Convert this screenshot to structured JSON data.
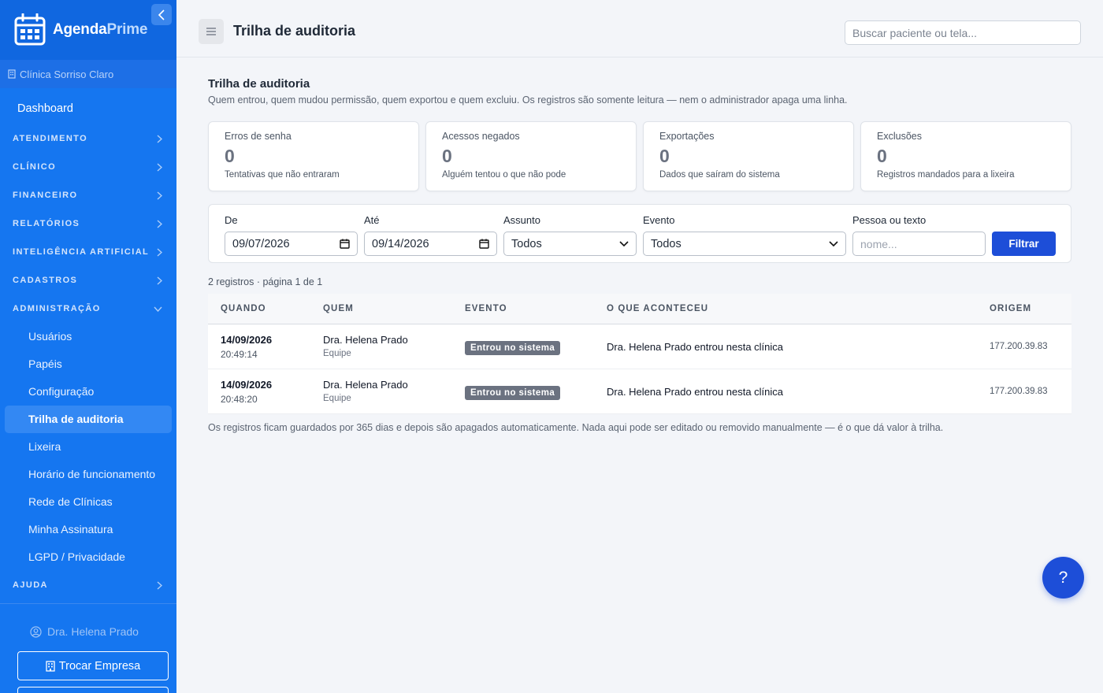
{
  "brand": {
    "name_part1": "Agenda",
    "name_part2": "Prime"
  },
  "sidebar": {
    "clinic": "Clínica Sorriso Claro",
    "dashboard": "Dashboard",
    "groups": [
      {
        "label": "ATENDIMENTO"
      },
      {
        "label": "CLÍNICO"
      },
      {
        "label": "FINANCEIRO"
      },
      {
        "label": "RELATÓRIOS"
      },
      {
        "label": "INTELIGÊNCIA ARTIFICIAL"
      },
      {
        "label": "CADASTROS"
      },
      {
        "label": "ADMINISTRAÇÃO"
      },
      {
        "label": "AJUDA"
      }
    ],
    "admin_items": [
      {
        "label": "Usuários"
      },
      {
        "label": "Papéis"
      },
      {
        "label": "Configuração"
      },
      {
        "label": "Trilha de auditoria",
        "active": true
      },
      {
        "label": "Lixeira"
      },
      {
        "label": "Horário de funcionamento"
      },
      {
        "label": "Rede de Clínicas"
      },
      {
        "label": "Minha Assinatura"
      },
      {
        "label": "LGPD / Privacidade"
      }
    ],
    "user": "Dra. Helena Prado",
    "switch_company": "Trocar Empresa"
  },
  "header": {
    "title": "Trilha de auditoria",
    "search_placeholder": "Buscar paciente ou tela..."
  },
  "main": {
    "title": "Trilha de auditoria",
    "description": "Quem entrou, quem mudou permissão, quem exportou e quem excluiu. Os registros são somente leitura — nem o administrador apaga uma linha.",
    "cards": [
      {
        "label": "Erros de senha",
        "value": "0",
        "sub": "Tentativas que não entraram"
      },
      {
        "label": "Acessos negados",
        "value": "0",
        "sub": "Alguém tentou o que não pode"
      },
      {
        "label": "Exportações",
        "value": "0",
        "sub": "Dados que saíram do sistema"
      },
      {
        "label": "Exclusões",
        "value": "0",
        "sub": "Registros mandados para a lixeira"
      }
    ],
    "filters": {
      "from_label": "De",
      "from_value": "09/07/2026",
      "to_label": "Até",
      "to_value": "09/14/2026",
      "subject_label": "Assunto",
      "subject_value": "Todos",
      "event_label": "Evento",
      "event_value": "Todos",
      "person_label": "Pessoa ou texto",
      "person_placeholder": "nome...",
      "button": "Filtrar"
    },
    "count": "2 registros · página 1 de 1",
    "table": {
      "headers": [
        "QUANDO",
        "QUEM",
        "EVENTO",
        "O QUE ACONTECEU",
        "ORIGEM"
      ],
      "rows": [
        {
          "date": "14/09/2026",
          "time": "20:49:14",
          "who": "Dra. Helena Prado",
          "role": "Equipe",
          "event": "Entrou no sistema",
          "what": "Dra. Helena Prado entrou nesta clínica",
          "origin": "177.200.39.83"
        },
        {
          "date": "14/09/2026",
          "time": "20:48:20",
          "who": "Dra. Helena Prado",
          "role": "Equipe",
          "event": "Entrou no sistema",
          "what": "Dra. Helena Prado entrou nesta clínica",
          "origin": "177.200.39.83"
        }
      ]
    },
    "footnote": "Os registros ficam guardados por 365 dias e depois são apagados automaticamente. Nada aqui pode ser editado ou removido manualmente — é o que dá valor à trilha."
  },
  "help_button": "?",
  "colors": {
    "sidebar": "#1576f0",
    "primary": "#1d4ed8",
    "badge": "#6b7280",
    "background": "#f3f5f9"
  }
}
